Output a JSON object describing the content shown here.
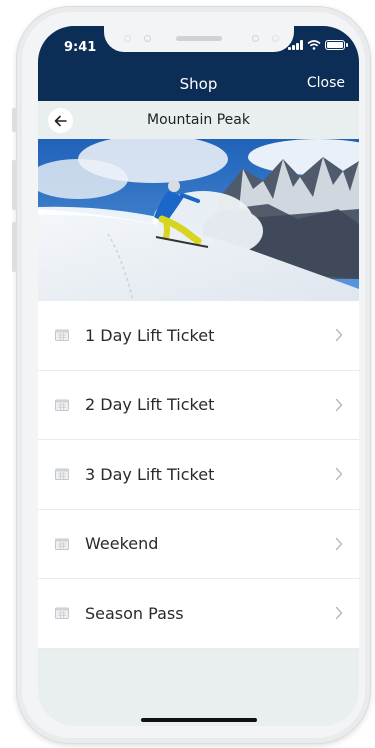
{
  "status_bar": {
    "time": "9:41"
  },
  "nav": {
    "title": "Shop",
    "close_label": "Close"
  },
  "subheader": {
    "title": "Mountain Peak"
  },
  "hero": {
    "description": "skier-on-snowy-mountain-photo"
  },
  "tickets": [
    {
      "label": "1 Day Lift Ticket",
      "icon": "calendar-icon"
    },
    {
      "label": "2 Day Lift Ticket",
      "icon": "calendar-icon"
    },
    {
      "label": "3 Day Lift Ticket",
      "icon": "calendar-icon"
    },
    {
      "label": "Weekend",
      "icon": "calendar-icon"
    },
    {
      "label": "Season Pass",
      "icon": "calendar-icon"
    }
  ],
  "colors": {
    "nav_background": "#0c2d55",
    "screen_background": "#e8efee",
    "row_background": "#ffffff"
  }
}
